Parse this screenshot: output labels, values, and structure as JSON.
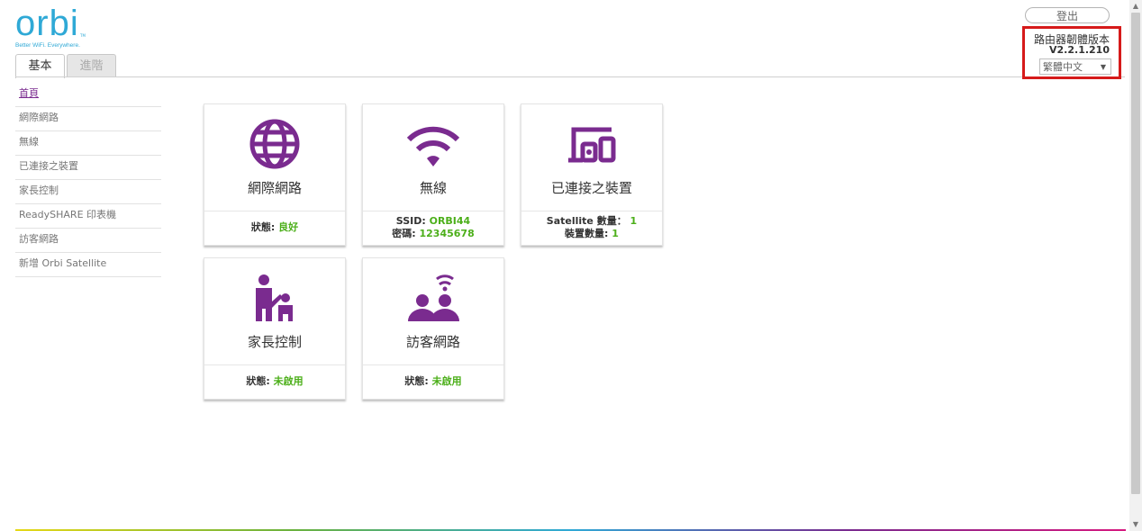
{
  "brand": {
    "logo_text": "orbi",
    "trademark": "TM",
    "tagline": "Better WiFi. Everywhere."
  },
  "tabs": [
    {
      "label": "基本",
      "active": true
    },
    {
      "label": "進階",
      "active": false
    }
  ],
  "header": {
    "logout_label": "登出",
    "firmware_label": "路由器韌體版本",
    "firmware_version": "V2.2.1.210",
    "language": {
      "selected": "繁體中文",
      "caret": "▼"
    }
  },
  "sidebar": {
    "items": [
      {
        "label": "首頁",
        "active": true
      },
      {
        "label": "網際網路"
      },
      {
        "label": "無線"
      },
      {
        "label": "已連接之裝置"
      },
      {
        "label": "家長控制"
      },
      {
        "label": "ReadySHARE 印表機"
      },
      {
        "label": "訪客網路"
      },
      {
        "label": "新增 Orbi Satellite"
      }
    ]
  },
  "cards": [
    {
      "title": "網際網路",
      "icon": "globe-icon",
      "status": [
        {
          "label": "狀態: ",
          "value": "良好"
        }
      ]
    },
    {
      "title": "無線",
      "icon": "wifi-icon",
      "status": [
        {
          "label": "SSID: ",
          "value": "ORBI44"
        },
        {
          "label": "密碼: ",
          "value": "12345678"
        }
      ]
    },
    {
      "title": "已連接之裝置",
      "icon": "devices-icon",
      "status": [
        {
          "label": "Satellite 數量： ",
          "value": "1"
        },
        {
          "label": "裝置數量: ",
          "value": "1"
        }
      ]
    },
    {
      "title": "家長控制",
      "icon": "parental-icon",
      "status": [
        {
          "label": "狀態: ",
          "value": "未啟用"
        }
      ]
    },
    {
      "title": "訪客網路",
      "icon": "guest-network-icon",
      "status": [
        {
          "label": "狀態: ",
          "value": "未啟用"
        }
      ]
    }
  ],
  "colors": {
    "brand_blue": "#2fa9d6",
    "accent_purple": "#7a2b8f",
    "status_green": "#4caf1a",
    "highlight_red": "#d61a1a"
  }
}
